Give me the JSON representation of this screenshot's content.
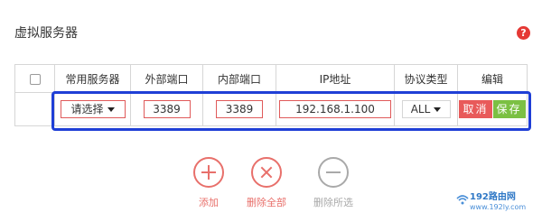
{
  "page": {
    "title": "虚拟服务器",
    "help_icon": "?"
  },
  "table": {
    "headers": {
      "select_all": "",
      "common_server": "常用服务器",
      "external_port": "外部端口",
      "internal_port": "内部端口",
      "ip_address": "IP地址",
      "protocol": "协议类型",
      "edit": "编辑"
    },
    "row": {
      "common_server": "请选择",
      "external_port": "3389",
      "internal_port": "3389",
      "ip_address": "192.168.1.100",
      "protocol": "ALL",
      "cancel_label": "取消",
      "save_label": "保存"
    }
  },
  "actions": {
    "add_label": "添加",
    "delete_all_label": "删除全部",
    "delete_selected_label": "删除所选"
  },
  "watermark": {
    "line1": "192路由网",
    "line2": "www.192ly.com"
  },
  "colors": {
    "accent_red": "#e8706b",
    "save_green": "#7bc043",
    "highlight_blue": "#1f3fd6",
    "disabled_gray": "#a9a9a9"
  }
}
